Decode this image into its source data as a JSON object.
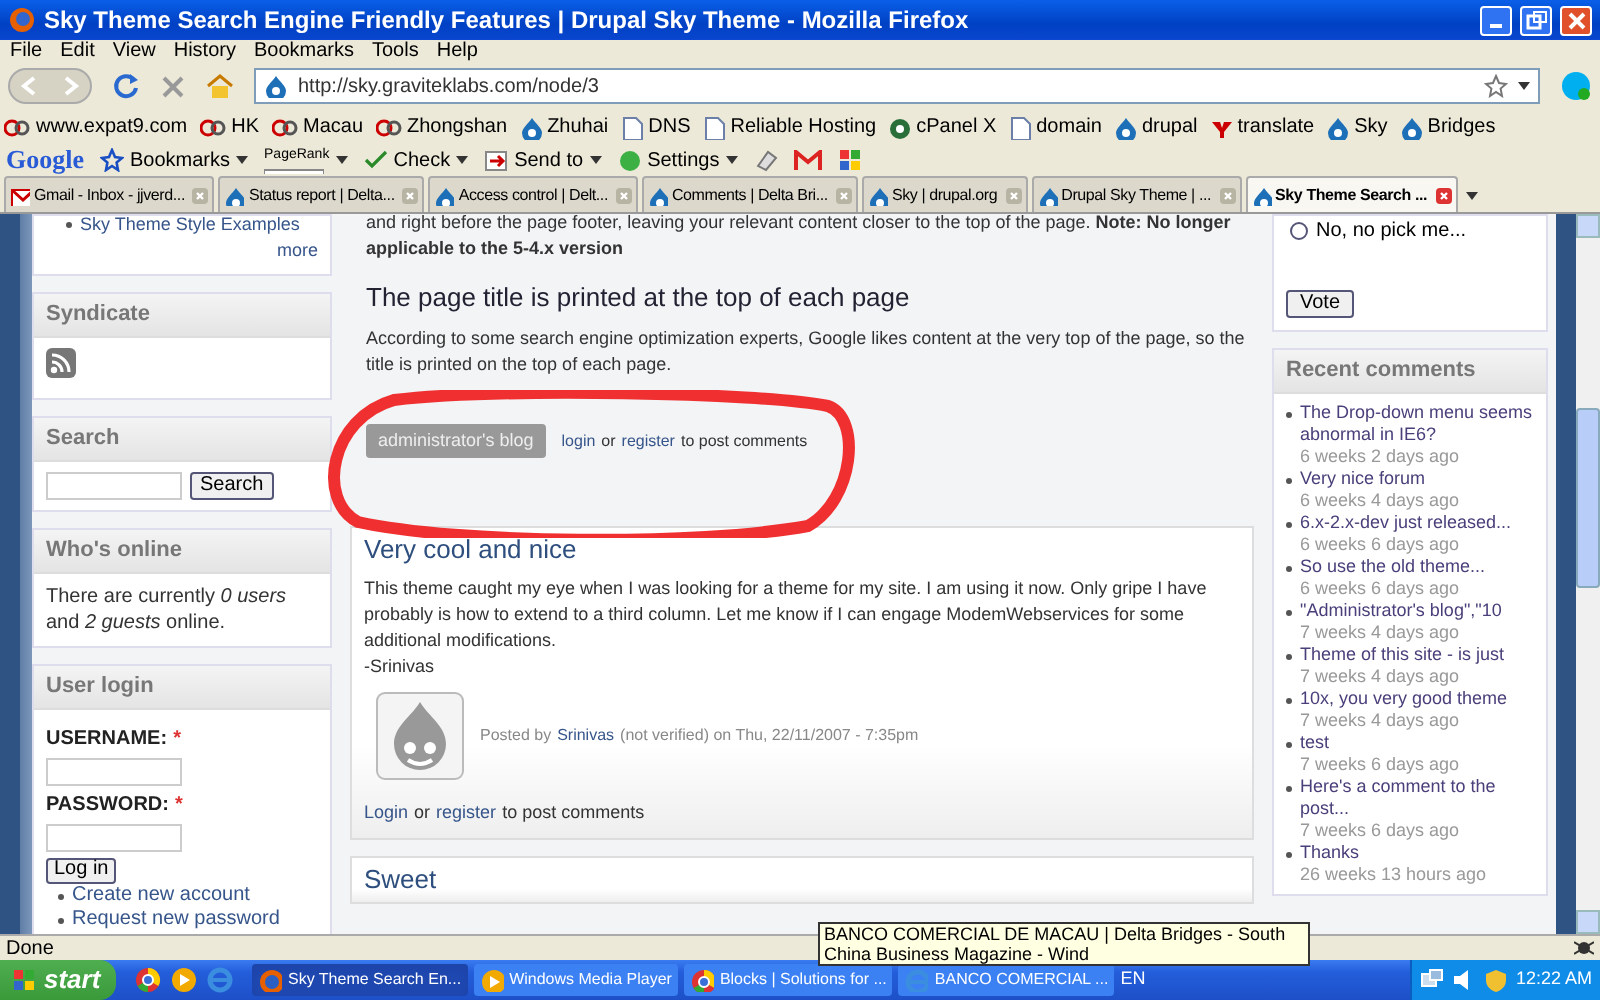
{
  "window": {
    "title": "Sky Theme Search Engine Friendly Features | Drupal Sky Theme - Mozilla Firefox"
  },
  "menu_bar": [
    "File",
    "Edit",
    "View",
    "History",
    "Bookmarks",
    "Tools",
    "Help"
  ],
  "navigation": {
    "url": "http://sky.graviteklabs.com/node/3"
  },
  "bookmarks": [
    {
      "label": "www.expat9.com",
      "kind": "expat"
    },
    {
      "label": "HK",
      "kind": "expat"
    },
    {
      "label": "Macau",
      "kind": "expat"
    },
    {
      "label": "Zhongshan",
      "kind": "expat"
    },
    {
      "label": "Zhuhai",
      "kind": "drupal"
    },
    {
      "label": "DNS",
      "kind": "page"
    },
    {
      "label": "Reliable Hosting",
      "kind": "page"
    },
    {
      "label": "cPanel X",
      "kind": "cpanel"
    },
    {
      "label": "domain",
      "kind": "page"
    },
    {
      "label": "drupal",
      "kind": "drupal"
    },
    {
      "label": "translate",
      "kind": "yahoo"
    },
    {
      "label": "Sky",
      "kind": "drupal"
    },
    {
      "label": "Bridges",
      "kind": "drupal"
    }
  ],
  "google_toolbar": {
    "logo": "Google",
    "items": [
      {
        "label": "Bookmarks",
        "kind": "star"
      },
      {
        "label": "PageRank",
        "kind": "pagerank"
      },
      {
        "label": "Check",
        "kind": "spell"
      },
      {
        "label": "Send to",
        "kind": "send"
      },
      {
        "label": "Settings",
        "kind": "settings"
      }
    ]
  },
  "tabs": [
    {
      "label": "Gmail - Inbox - jjverd...",
      "kind": "gmail",
      "selected": false
    },
    {
      "label": "Status report | Delta...",
      "kind": "drupal",
      "selected": false
    },
    {
      "label": "Access control | Delt...",
      "kind": "drupal",
      "selected": false
    },
    {
      "label": "Comments | Delta Bri...",
      "kind": "drupal",
      "selected": false
    },
    {
      "label": "Sky | drupal.org",
      "kind": "drupal",
      "selected": false
    },
    {
      "label": "Drupal Sky Theme | ...",
      "kind": "drupal",
      "selected": false
    },
    {
      "label": "Sky Theme Search ...",
      "kind": "drupal",
      "selected": true
    }
  ],
  "left_sidebar": {
    "top_link": "Sky Theme Style Examples",
    "more": "more",
    "syndicate": {
      "title": "Syndicate"
    },
    "search": {
      "title": "Search",
      "button": "Search"
    },
    "whos_online": {
      "title": "Who's online",
      "text": "There are currently *0 users* and *2 guests* online."
    },
    "user_login": {
      "title": "User login",
      "fields": [
        {
          "label": "USERNAME:",
          "required_mark": "*"
        },
        {
          "label": "PASSWORD:",
          "required_mark": "*"
        }
      ],
      "button": "Log in",
      "links": [
        "Create new account",
        "Request new password"
      ]
    }
  },
  "article": {
    "intro": "and right before the page footer, leaving your relevant content closer to the top of the page. **Note: No longer applicable to the 5-4.x version**",
    "heading": "The page title is printed at the top of each page",
    "body": "According to some search engine optimization experts, Google likes content at the very top of the page, so the title is printed on the top of each page.",
    "tag": "administrator's blog",
    "links": [
      {
        "text": "login",
        "link": true
      },
      {
        "text": "or",
        "link": false
      },
      {
        "text": "register",
        "link": true
      },
      {
        "text": "to post comments",
        "link": false
      }
    ]
  },
  "comments": [
    {
      "title": "Very cool and nice",
      "body": "This theme caught my eye when I was looking for a theme for my site. I am using it now. Only gripe I have probably is how to extend to a third column. Let me know if I can engage ModemWebservices for some additional modifications.",
      "signature": "-Srinivas",
      "meta": [
        {
          "text": "Posted by",
          "link": false
        },
        {
          "text": "Srinivas",
          "link": true
        },
        {
          "text": "(not verified) on Thu, 22/11/2007 - 7:35pm",
          "link": false
        }
      ],
      "links": [
        {
          "text": "Login",
          "link": true
        },
        {
          "text": "or",
          "link": false
        },
        {
          "text": "register",
          "link": true
        },
        {
          "text": "to post comments",
          "link": false
        }
      ]
    },
    {
      "title": "Sweet"
    }
  ],
  "right_sidebar": {
    "poll": {
      "option": {
        "label": "No, no pick me...",
        "selected": false
      },
      "button": "Vote"
    },
    "recent_comments": {
      "title": "Recent comments",
      "items": [
        {
          "title": "The Drop-down menu seems abnormal in IE6?",
          "time": "6 weeks 2 days ago"
        },
        {
          "title": "Very nice forum",
          "time": "6 weeks 4 days ago"
        },
        {
          "title": "6.x-2.x-dev just released...",
          "time": "6 weeks 6 days ago"
        },
        {
          "title": "So use the old theme...",
          "time": "6 weeks 6 days ago"
        },
        {
          "title": "\"Administrator's blog\",\"10",
          "time": "7 weeks 4 days ago"
        },
        {
          "title": "Theme of this site - is just",
          "time": "7 weeks 4 days ago"
        },
        {
          "title": "10x, you very good theme",
          "time": "7 weeks 4 days ago"
        },
        {
          "title": "test",
          "time": "7 weeks 6 days ago"
        },
        {
          "title": "Here's a comment to the post...",
          "time": "7 weeks 6 days ago"
        },
        {
          "title": "Thanks",
          "time": "26 weeks 13 hours ago"
        }
      ]
    }
  },
  "status_bar": {
    "text": "Done"
  },
  "tooltip": {
    "text": "BANCO COMERCIAL DE MACAU | Delta Bridges - South China Business Magazine - Wind"
  },
  "taskbar": {
    "start": "start",
    "tasks": [
      {
        "label": "Sky Theme Search En...",
        "kind": "firefox",
        "selected": true
      },
      {
        "label": "Windows Media Player",
        "kind": "media",
        "selected": false
      },
      {
        "label": "Blocks | Solutions for ...",
        "kind": "chrome",
        "selected": false
      },
      {
        "label": "BANCO COMERCIAL ...",
        "kind": "ie",
        "selected": false
      }
    ],
    "language": "EN",
    "clock": "12:22 AM"
  }
}
